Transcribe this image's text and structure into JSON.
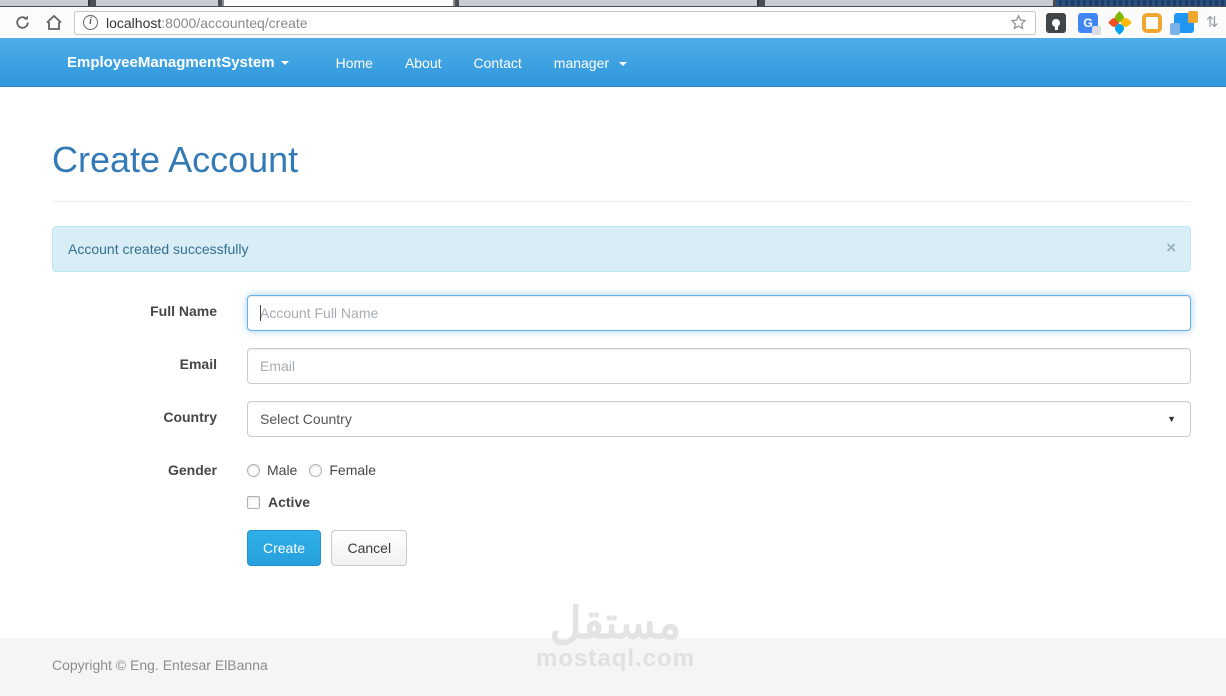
{
  "browser": {
    "url": {
      "host": "localhost",
      "path": ":8000/accounteq/create"
    },
    "icons": [
      "reload-icon",
      "home-icon",
      "page-info-icon",
      "bookmark-star-icon",
      "lightbulb-extension-icon",
      "translate-extension-icon",
      "photos-extension-icon",
      "orange-extension-icon",
      "docs-extension-icon",
      "overflow-extension-icon"
    ],
    "translate_letter": "G"
  },
  "navbar": {
    "brand": "EmployeeManagmentSystem",
    "links": [
      {
        "label": "Home"
      },
      {
        "label": "About"
      },
      {
        "label": "Contact"
      }
    ],
    "user_menu": {
      "label": "manager"
    }
  },
  "main": {
    "title": "Create Account",
    "alert": {
      "message": "Account created successfully",
      "close_label": "×"
    },
    "form": {
      "full_name": {
        "label": "Full Name",
        "placeholder": "Account Full Name",
        "value": ""
      },
      "email": {
        "label": "Email",
        "placeholder": "Email",
        "value": ""
      },
      "country": {
        "label": "Country",
        "selected": "Select Country",
        "arrow": "▼"
      },
      "gender": {
        "label": "Gender",
        "options": [
          {
            "label": "Male",
            "checked": false
          },
          {
            "label": "Female",
            "checked": false
          }
        ]
      },
      "active": {
        "label": "Active",
        "checked": false
      },
      "buttons": {
        "create": "Create",
        "cancel": "Cancel"
      }
    }
  },
  "footer": {
    "copyright": "Copyright © Eng. Entesar ElBanna"
  },
  "watermark": {
    "arabic": "مستقل",
    "latin": "mostaql.com"
  },
  "colors": {
    "navbar_top": "#4fade9",
    "navbar_bottom": "#2e97da",
    "heading_blue": "#337ab7",
    "button_blue": "#29a9e2",
    "alert_bg": "#d9edf7",
    "alert_border": "#bce8f1",
    "alert_text": "#31708f",
    "focus_border": "#66afe9",
    "footer_bg": "#f5f5f5"
  }
}
